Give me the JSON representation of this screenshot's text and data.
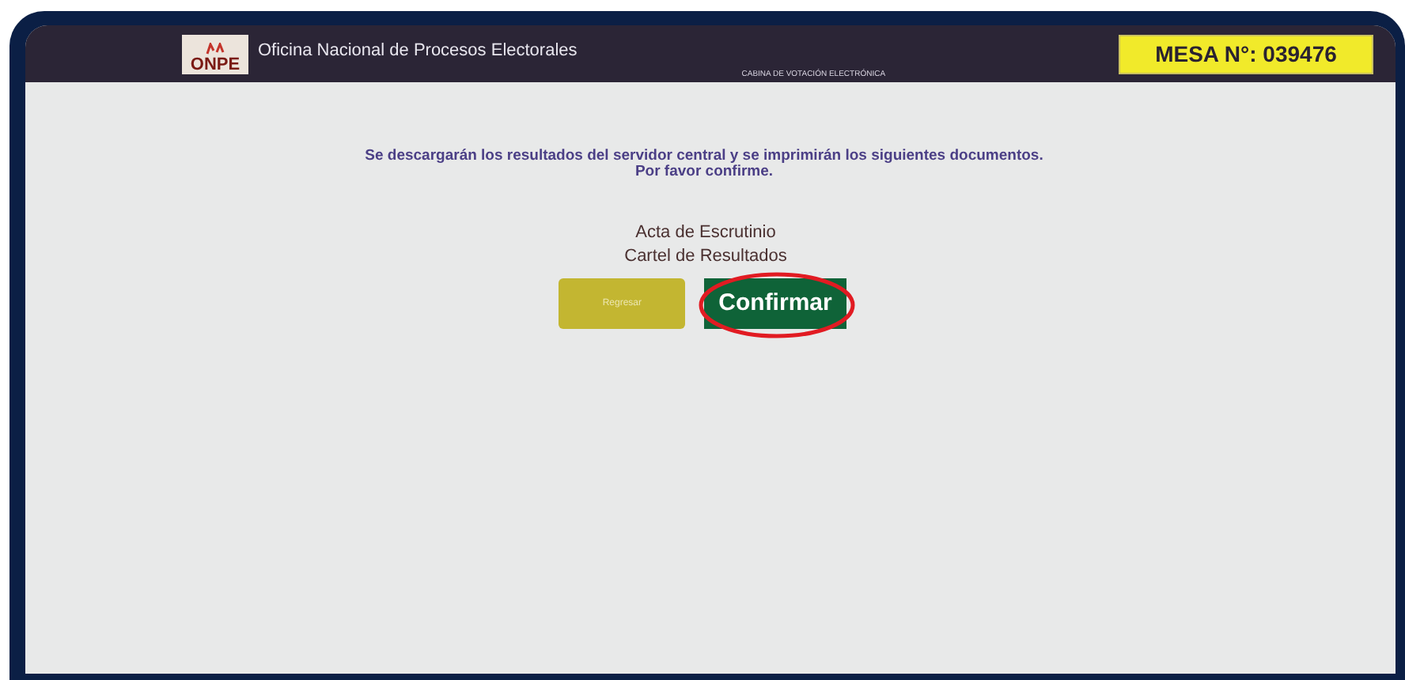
{
  "header": {
    "logo_text": "ONPE",
    "org_name": "Oficina Nacional de Procesos Electorales",
    "subtitle": "CABINA DE VOTACIÓN ELECTRÓNICA",
    "mesa": "MESA N°: 039476"
  },
  "message": [
    "Se descargarán los resultados del servidor central y se imprimirán los siguientes documentos.",
    "Por favor confirme."
  ],
  "documents": [
    "Acta de Escrutinio",
    "Cartel de Resultados"
  ],
  "buttons": [
    {
      "label": "Regresar",
      "kind": "secondary",
      "highlighted": false
    },
    {
      "label": "Confirmar",
      "kind": "primary",
      "highlighted": true
    }
  ]
}
